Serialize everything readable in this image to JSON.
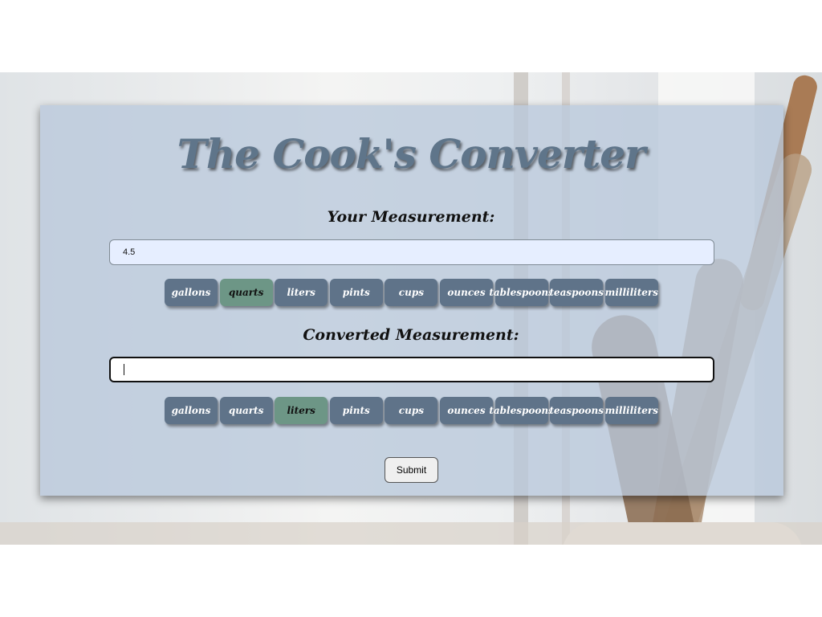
{
  "title": "The Cook's Converter",
  "from": {
    "label": "Your Measurement:",
    "value": "4.5",
    "selected_unit": "quarts"
  },
  "to": {
    "label": "Converted Measurement:",
    "value": "",
    "selected_unit": "liters"
  },
  "units": [
    "gallons",
    "quarts",
    "liters",
    "pints",
    "cups",
    "ounces",
    "tablespoons",
    "teaspoons",
    "milliliters"
  ],
  "submit_label": "Submit",
  "colors": {
    "card": "#b8c8db",
    "unit_button": "#5f7389",
    "unit_button_selected": "#6d9686",
    "title": "#5f758a"
  }
}
